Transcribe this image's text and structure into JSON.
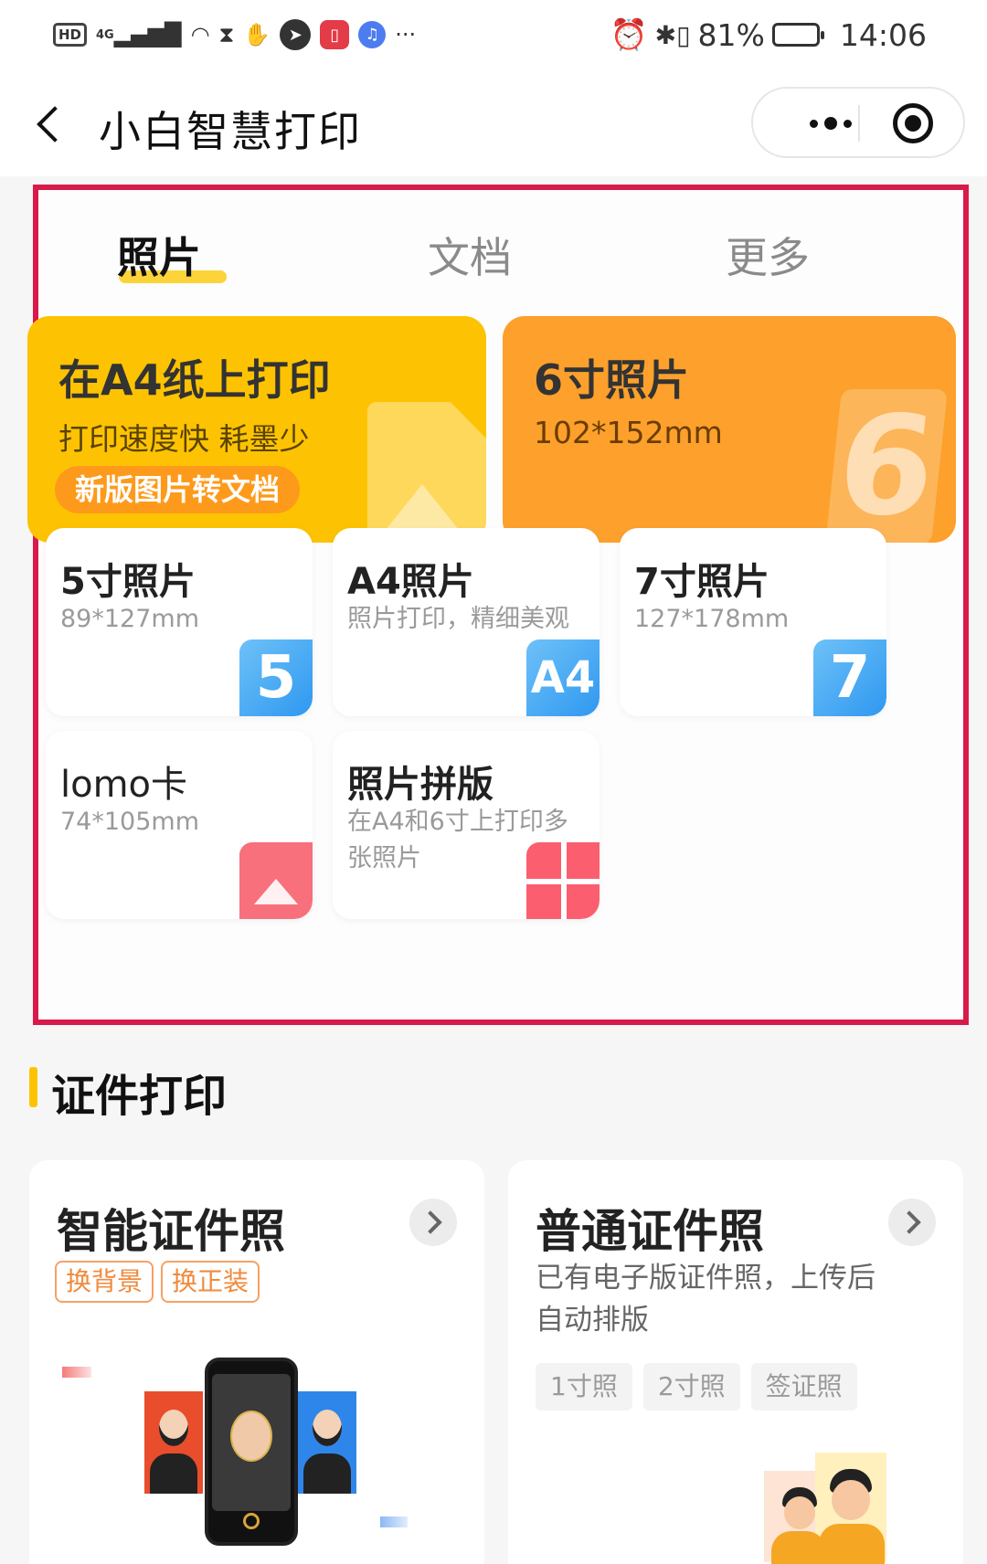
{
  "status_bar": {
    "left_icons": [
      "hd-icon",
      "signal-4g-icon",
      "wifi-icon",
      "hourglass-icon",
      "hand-icon",
      "shield-icon",
      "book-app-icon",
      "music-app-icon",
      "more-dots-icon"
    ],
    "hd_label": "HD",
    "network_label": "4G",
    "more_label": "···",
    "battery_percent": "81%",
    "battery_level": 81,
    "time": "14:06"
  },
  "nav": {
    "title": "小白智慧打印"
  },
  "photo_tabs": [
    {
      "label": "照片",
      "active": true
    },
    {
      "label": "文档",
      "active": false
    },
    {
      "label": "更多",
      "active": false
    }
  ],
  "feature_cards": [
    {
      "title": "在A4纸上打印",
      "subtitle": "打印速度快 耗墨少",
      "badge": "新版图片转文档",
      "color": "#fdc302"
    },
    {
      "title": "6寸照片",
      "subtitle": "102*152mm",
      "icon_text": "6",
      "color": "#fda02c"
    }
  ],
  "size_cards": [
    {
      "title": "5寸照片",
      "subtitle": "89*127mm",
      "icon_text": "5"
    },
    {
      "title": "A4照片",
      "subtitle": "照片打印，精细美观",
      "icon_text": "A4"
    },
    {
      "title": "7寸照片",
      "subtitle": "127*178mm",
      "icon_text": "7"
    },
    {
      "title": "lomo卡",
      "subtitle": "74*105mm",
      "icon": "image-icon"
    },
    {
      "title": "照片拼版",
      "subtitle": "在A4和6寸上打印多张照片",
      "icon": "collage-grid-icon"
    }
  ],
  "id_section": {
    "title": "证件打印",
    "smart": {
      "title": "智能证件照",
      "tags": [
        "换背景",
        "换正装"
      ]
    },
    "normal": {
      "title": "普通证件照",
      "description": "已有电子版证件照，上传后自动排版",
      "chips": [
        "1寸照",
        "2寸照",
        "签证照"
      ]
    }
  },
  "colors": {
    "accent_yellow": "#fdc302",
    "accent_orange": "#fda02c",
    "highlight_border": "#d81a4b",
    "tag_orange": "#f08a3c"
  }
}
